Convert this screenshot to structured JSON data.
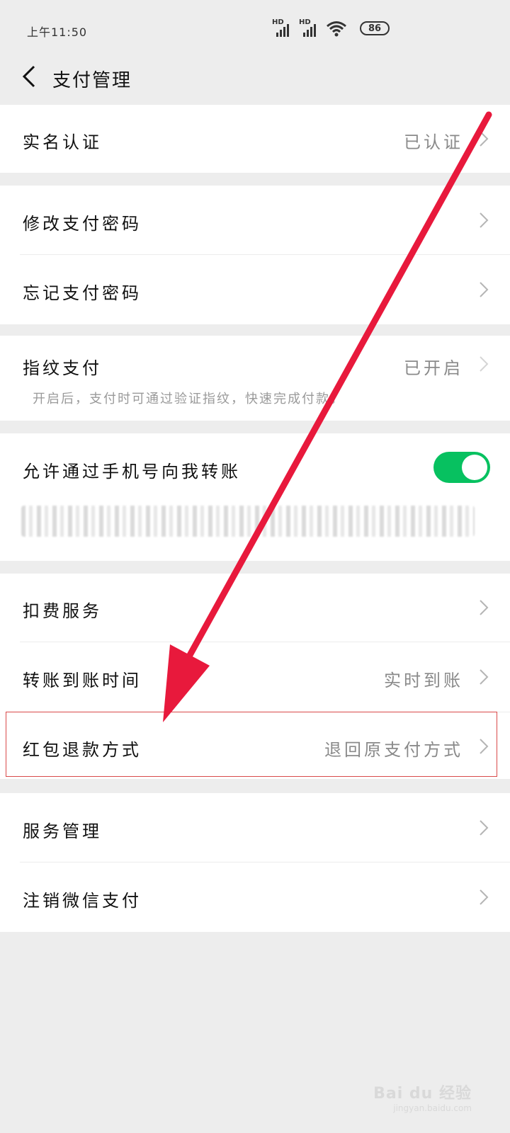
{
  "status_bar": {
    "time": "上午11:50",
    "network_1": "HD",
    "network_2": "HD",
    "battery": "86"
  },
  "nav": {
    "title": "支付管理"
  },
  "items": {
    "real_name": {
      "label": "实名认证",
      "value": "已认证"
    },
    "change_pwd": {
      "label": "修改支付密码"
    },
    "forgot_pwd": {
      "label": "忘记支付密码"
    },
    "fingerprint": {
      "label": "指纹支付",
      "value": "已开启",
      "desc": "开启后，支付时可通过验证指纹，快速完成付款。"
    },
    "phone_transfer": {
      "label": "允许通过手机号向我转账",
      "toggle_on": true
    },
    "deduction": {
      "label": "扣费服务"
    },
    "transfer_time": {
      "label": "转账到账时间",
      "value": "实时到账"
    },
    "red_packet_refund": {
      "label": "红包退款方式",
      "value": "退回原支付方式"
    },
    "service_manage": {
      "label": "服务管理"
    },
    "cancel_wechat_pay": {
      "label": "注销微信支付"
    }
  },
  "colors": {
    "toggle_on": "#07c160",
    "arrow": "#e8193c",
    "highlight_border": "#d94a4a",
    "background": "#ededed"
  },
  "watermark": {
    "text": "Bai du 经验",
    "domain": "jingyan.baidu.com"
  }
}
